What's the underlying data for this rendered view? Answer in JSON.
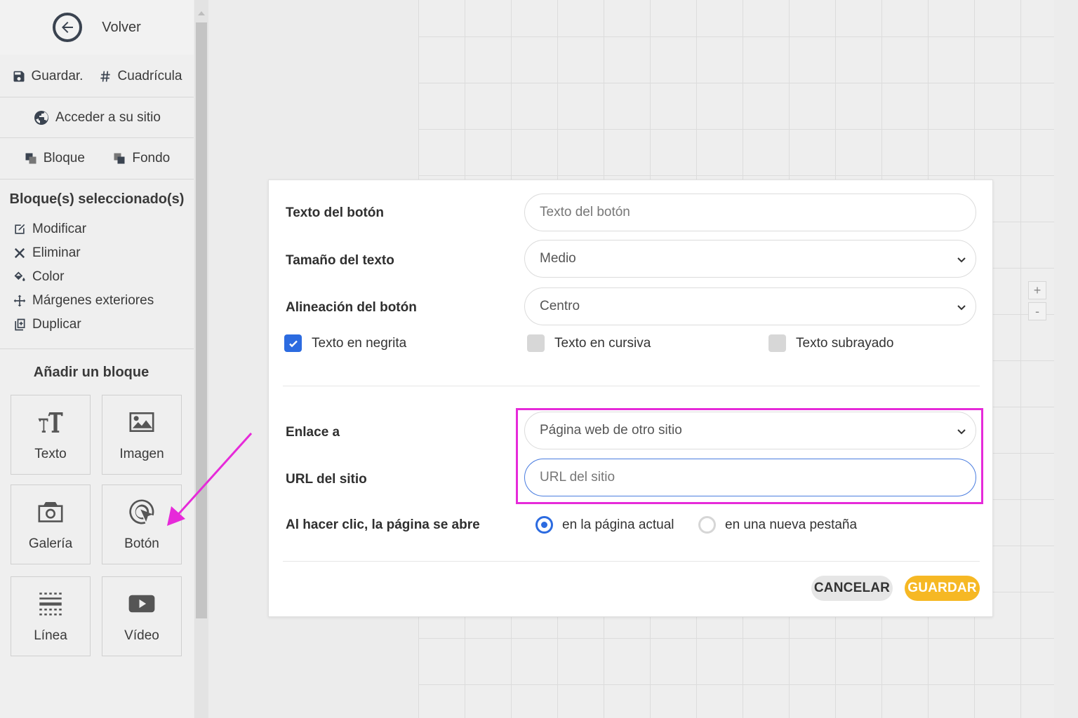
{
  "sidebar": {
    "back_label": "Volver",
    "save_label": "Guardar.",
    "grid_label": "Cuadrícula",
    "visit_site_label": "Acceder a su sitio",
    "block_label": "Bloque",
    "background_label": "Fondo",
    "selected_title": "Bloque(s) seleccionado(s)",
    "actions": [
      {
        "label": "Modificar",
        "icon": "edit-icon"
      },
      {
        "label": "Eliminar",
        "icon": "close-icon"
      },
      {
        "label": "Color",
        "icon": "paint-bucket-icon"
      },
      {
        "label": "Márgenes exteriores",
        "icon": "move-icon"
      },
      {
        "label": "Duplicar",
        "icon": "duplicate-icon"
      }
    ],
    "add_block_title": "Añadir un bloque",
    "blocks": [
      {
        "label": "Texto",
        "icon": "text-size-icon"
      },
      {
        "label": "Imagen",
        "icon": "image-icon"
      },
      {
        "label": "Galería",
        "icon": "camera-icon"
      },
      {
        "label": "Botón",
        "icon": "click-icon"
      },
      {
        "label": "Línea",
        "icon": "line-icon"
      },
      {
        "label": "Vídeo",
        "icon": "youtube-icon"
      }
    ]
  },
  "canvas": {
    "zoom_in": "+",
    "zoom_out": "-"
  },
  "dialog": {
    "button_text_label": "Texto del botón",
    "button_text_placeholder": "Texto del botón",
    "text_size_label": "Tamaño del texto",
    "text_size_value": "Medio",
    "alignment_label": "Alineación del botón",
    "alignment_value": "Centro",
    "bold_label": "Texto en negrita",
    "bold_checked": true,
    "italic_label": "Texto en cursiva",
    "italic_checked": false,
    "underline_label": "Texto subrayado",
    "underline_checked": false,
    "link_label": "Enlace a",
    "link_value": "Página web de otro sitio",
    "url_label": "URL del sitio",
    "url_placeholder": "URL del sitio",
    "open_label": "Al hacer clic, la página se abre",
    "open_current": "en la página actual",
    "open_new_tab": "en una nueva pestaña",
    "open_selected": "current",
    "cancel_label": "CANCELAR",
    "save_label": "GUARDAR"
  },
  "colors": {
    "accent": "#2c6be0",
    "save_button": "#f6b824",
    "highlight": "#e62ad9"
  }
}
